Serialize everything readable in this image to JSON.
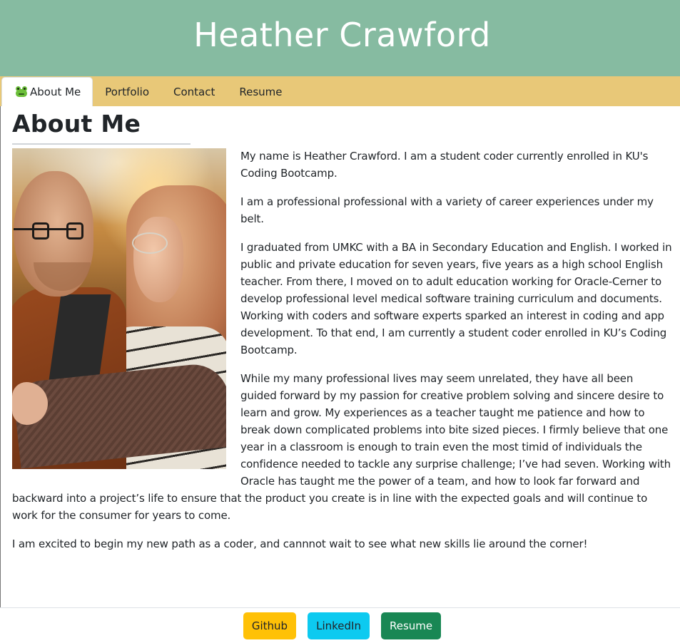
{
  "header": {
    "title": "Heather Crawford"
  },
  "nav": {
    "tabs": [
      {
        "label": "About Me",
        "icon": "frog-icon",
        "active": true
      },
      {
        "label": "Portfolio"
      },
      {
        "label": "Contact"
      },
      {
        "label": "Resume"
      }
    ]
  },
  "about": {
    "title": "About Me",
    "paragraphs": [
      "My name is Heather Crawford. I am a student coder currently enrolled in KU's Coding Bootcamp.",
      "I am a professional professional with a variety of career experiences under my belt.",
      "I graduated from UMKC with a BA in Secondary Education and English. I worked in public and private education for seven years, five years as a high school English teacher. From there, I moved on to adult education working for Oracle-Cerner to develop professional level medical software training curriculum and documents. Working with coders and software experts sparked an interest in coding and app development. To that end, I am currently a student coder enrolled in KU’s Coding Bootcamp.",
      "While my many professional lives may seem unrelated, they have all been guided forward by my passion for creative problem solving and sincere desire to learn and grow. My experiences as a teacher taught me patience and how to break down complicated problems into bite sized pieces. I firmly believe that one year in a classroom is enough to train even the most timid of individuals the confidence needed to tackle any surprise challenge; I’ve had seven. Working with Oracle has taught me the power of a team, and how to look far forward and backward into a project’s life to ensure that the product you create is in line with the expected goals and will continue to work for the consumer for years to come.",
      "I am excited to begin my new path as a coder, and cannnot wait to see what new skills lie around the corner!"
    ]
  },
  "footer": {
    "github_label": "Github",
    "linkedin_label": "LinkedIn",
    "resume_label": "Resume"
  },
  "colors": {
    "header_bg": "#86bba1",
    "nav_bg": "#e8c878",
    "github_btn": "#ffc107",
    "linkedin_btn": "#0dcaf0",
    "resume_btn": "#198754"
  }
}
